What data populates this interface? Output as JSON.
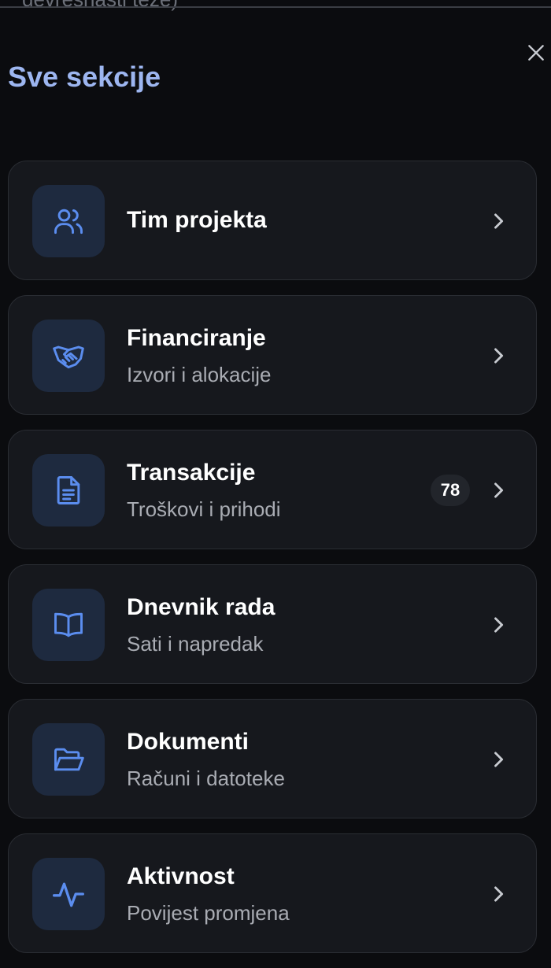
{
  "header": {
    "cut_off_text": "devrésnasti teze)",
    "title": "Sve sekcije"
  },
  "colors": {
    "accent": "#5b8def",
    "title": "#9db6f0",
    "card_bg": "#16181d",
    "icon_bg": "#1e2a3f"
  },
  "sections": [
    {
      "title": "Tim projekta",
      "subtitle": "",
      "icon": "users-icon"
    },
    {
      "title": "Financiranje",
      "subtitle": "Izvori i alokacije",
      "icon": "handshake-icon"
    },
    {
      "title": "Transakcije",
      "subtitle": "Troškovi i prihodi",
      "icon": "document-icon",
      "badge": "78"
    },
    {
      "title": "Dnevnik rada",
      "subtitle": "Sati i napredak",
      "icon": "book-open-icon"
    },
    {
      "title": "Dokumenti",
      "subtitle": "Računi i datoteke",
      "icon": "folder-open-icon"
    },
    {
      "title": "Aktivnost",
      "subtitle": "Povijest promjena",
      "icon": "activity-icon"
    }
  ]
}
